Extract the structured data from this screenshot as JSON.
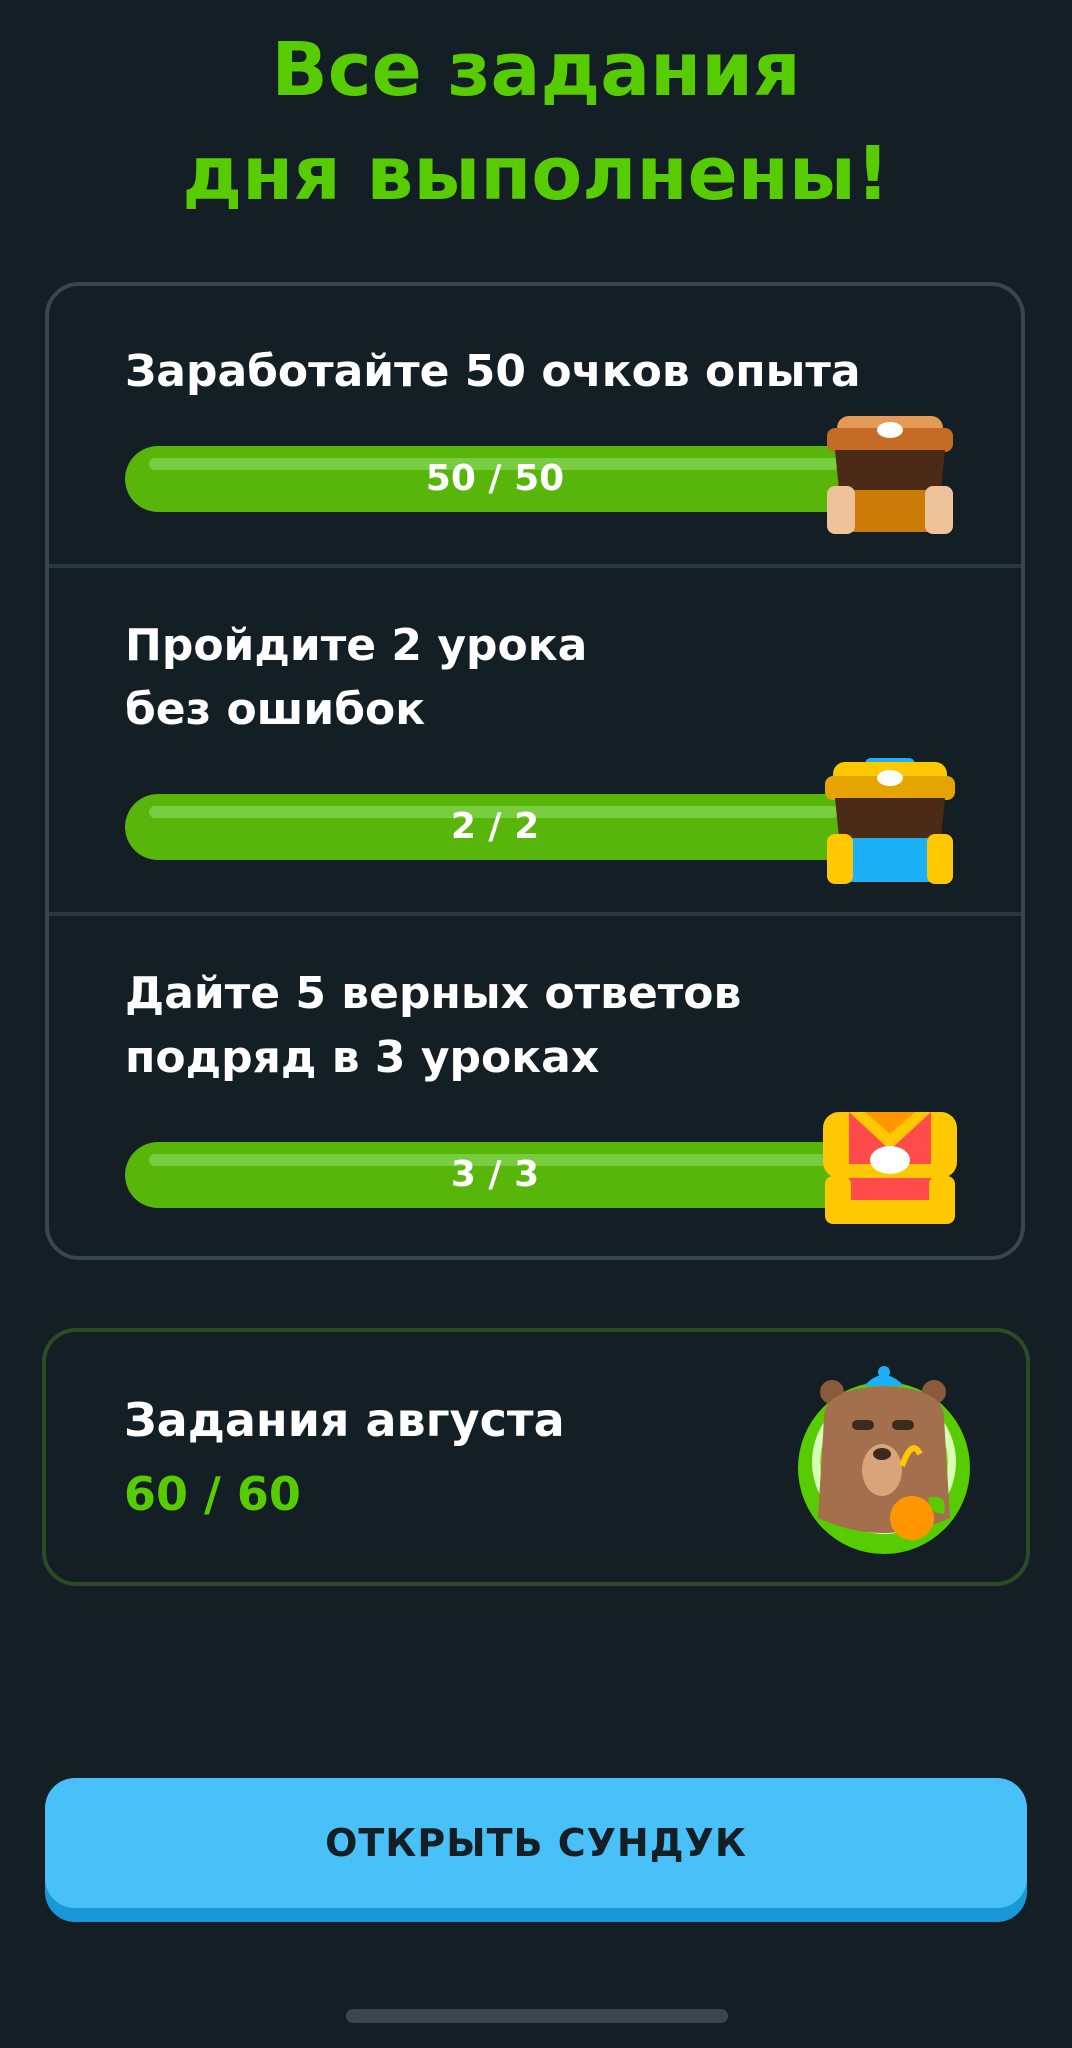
{
  "header": {
    "title": "Все задания\nдня выполнены!"
  },
  "quests": [
    {
      "text": "Заработайте 50 очков опыта",
      "progress_label": "50 / 50",
      "progress": 1.0,
      "reward_icon": "bronze-chest-icon"
    },
    {
      "text": "Пройдите 2 урока\nбез ошибок",
      "progress_label": "2 / 2",
      "progress": 1.0,
      "reward_icon": "gold-chest-icon"
    },
    {
      "text": "Дайте 5 верных ответов\nподряд в 3 уроках",
      "progress_label": "3 / 3",
      "progress": 1.0,
      "reward_icon": "red-gold-chest-icon"
    }
  ],
  "monthly": {
    "title": "Задания августа",
    "count_label": "60  / 60",
    "badge_icon": "bear-badge-icon"
  },
  "actions": {
    "open_chest_label": "ОТКРЫТЬ СУНДУК"
  },
  "colors": {
    "background": "#131f24",
    "accent_green": "#58cc02",
    "button_blue": "#49c0f8"
  }
}
